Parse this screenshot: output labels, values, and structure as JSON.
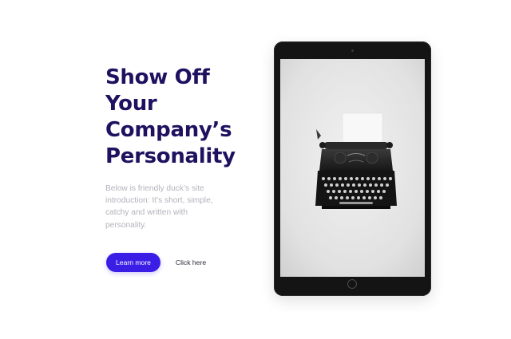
{
  "hero": {
    "title_lines": [
      "Show Off",
      "Your",
      "Company’s",
      "Personality"
    ],
    "description": "Below is friendly duck’s site introduction: It’s short, simple, catchy and written with personality.",
    "primary_button": "Learn more",
    "secondary_button": "Click here"
  },
  "device": {
    "type": "tablet",
    "screen_image": "typewriter-photo"
  },
  "colors": {
    "heading": "#1f1160",
    "body_text": "#b3b3bd",
    "accent": "#3a1ee6",
    "device_frame": "#141414"
  }
}
